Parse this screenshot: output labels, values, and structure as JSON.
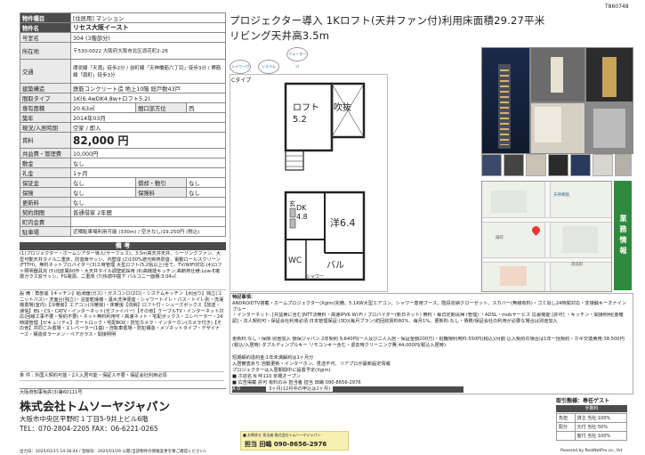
{
  "corner_id": "T860748",
  "spec": {
    "rows": [
      {
        "label": "物件種目",
        "value": "[住居用] マンション"
      },
      {
        "label": "物件名",
        "value": "リセス大阪イースト"
      },
      {
        "label": "号室名",
        "value": "304 (3階部分)"
      },
      {
        "label": "所在地",
        "value": "〒530-0022 大阪府大阪市北区浪花町2-28"
      },
      {
        "label": "交通",
        "value": "環状線「天満」徒歩2分 / 谷町線「天神橋筋六丁目」徒歩3分 / 堺筋線「扇町」徒歩3分"
      },
      {
        "label": "建築構造",
        "value": "鉄筋コンクリート造 地上10階 総戸数43戸"
      },
      {
        "label": "間取タイプ",
        "value": "1K(6.4wDK4.8w+ロフト5.2)"
      },
      {
        "label": "専有面積",
        "value": "20.63㎡"
      },
      {
        "label": "築年",
        "value": "2014年03月"
      },
      {
        "label": "現況/入居時期",
        "value": "空家 / 即入"
      }
    ],
    "side_label": "間口部方位",
    "side_value": "西",
    "rent_label": "賃料",
    "rent_value": "82,000 円",
    "rows2": [
      {
        "label": "共益費・管理費",
        "value": "10,000円"
      },
      {
        "label": "敷金",
        "value": "なし"
      },
      {
        "label": "礼金",
        "value": "1ヶ月"
      },
      {
        "label": "保証金",
        "value": "なし",
        "label2": "償却・敷引",
        "value2": "なし"
      },
      {
        "label": "保険",
        "value": "なし",
        "label2": "保険料",
        "value2": "なし"
      },
      {
        "label": "更新料",
        "value": "なし"
      },
      {
        "label": "契約期間",
        "value": "普通借家 2年間"
      },
      {
        "label": "町内会費",
        "value": ""
      },
      {
        "label": "駐車場",
        "value": "近隣駐車場利用可能 (330m) / 空きなし/19,250円 (税込)"
      }
    ]
  },
  "notes": {
    "title": "備 考",
    "body1": "(1)プロジェクター・ホームシアター導入(サーフェス)、3.5m高天井天井、シーリングファン、大型可動天井タイル二重床、防音扉サッシ、内壁成 (2)100%遮光断熱防音、電動ロールスクリーン(FTTH)、無料ネットブロバイダー(3)エ時管理 大型ロフト(5.2帖以上)全て、TV/WIFI対応 (4)ロフト照明器具完 (5)北欧風60作・大天井タイル調壁紙採用 (6)高機能キッチン:高断熱仕様:Low-E複層ガラス窓サッシ、FG電源、二重床 (7)快適中庭下 バルコニー面積:3.04㎡",
    "body2": "設 備 : 角部屋【キッチン】給湯器(ガス)・ガスコンロ(2口)・システムキッチン【水回り】独立(ユニットバス)・洗面台(独立)・浴室乾燥機・温水洗浄便座・シャワートイレ・バス・トイレ別・洗濯機置場(室内)【冷暖房】エアコン(冷暖房)・床暖房【収納】ロフト付・シューズボックス【放送・通信】BS・CS・CATV・インターネット(光ファイバー)【その他】ケーブルTV・インターネット対応(回線工事不要・契約不要)・ネット無料利用可・高速ネット・宅配ボックス・エレベーター・24時間管理【セキュリティ】オートロック・宅配BOX・防犯カメラ・インターホン(カメラ付き)【その他】共同ごみ置場・エレベーター(1基)・自転車置場・防犯構造・メゾネットタイプ・デザイナーズ・構造体ラーメン・ペアガラス・間接照明",
    "conditions": "条 件 : 外国人契約可能・2人入居可能・保証人不要・保証会社利用必須"
  },
  "company": {
    "license": "大阪府知事免許(3)第60111号",
    "name": "株式会社トムソーヤジャパン",
    "address": "大阪市中央区平野町１丁目5-9井上ビル6階",
    "tel_fax": "TEL：070-2804-2205 FAX：06-6221-0265"
  },
  "headline": "プロジェクター導入 1Kロフト(天井ファン付)利用床面積29.27平米 リビング天井高3.5m",
  "icons": [
    "シャワー付",
    "システム",
    "ウォーターロ"
  ],
  "floorplan": {
    "type_label": "Cタイプ",
    "loft_label": "ロフト",
    "loft_size": "5.2",
    "atrium": "吹抜",
    "dk_label": "DK",
    "dk_size": "4.8",
    "yo_label": "洋6.4",
    "wc": "WC",
    "balcony": "バル",
    "entry": "玄",
    "shower": "シャワー"
  },
  "side_badge": "業務情報",
  "map_labels": [
    "天神橋筋",
    "浪花町",
    "扇町"
  ],
  "special": {
    "title": "特記事項：",
    "body": "ANDROIDTV搭載・ホームプロジェクター(Xgim)完備、5.1KW大型エアコン、シャワー専用ブース、階段収納クローゼット、スカバー(無線有料)・ゴミ出し24時間対応・非接触キーオナインブルー",
    "body_b": "・インターネット: [共益費に含む]NTT法無料・高速IPV6 Wi-Fi / プロバイダー(新日ネット) 無料・毎日定期清掃 (管理) ・ADSL・mobサービス 応募機能 [許可] ・キッチン・間接照明[要確認]・法人契約可・保証会社利用必須 日本管理保証:(3D)(毎月プラン)初回総賃料80%、毎月1%、更新料:なし・債務/保証会社の利用が必要な場合は別途加入",
    "body_c": "更新料:なし・保険:別途加入 損保ジャパン 2年契約 9,640円(一人及び二人入居・保証金額200万)・駐輪場利用料:550円(税込)/月額 込入契約の場合は1年一括契約・カギ交換費用:38,500円(税込/入居時) ダブルディンプルキー リモコンキー含む・退去時クリーニング費:44,000円(税込入居時)",
    "body_d": "短期解約違約金:1年未満解約は1ヶ月分",
    "body_e": "入居審査あり:自動更新・インターホン、見送不可、リアプロが最新設定情報",
    "body_f": "プロジェクターは入居期間中に設置予定(Xgim)",
    "store_label": "■ ホ店名",
    "store": "N 呼110 京橋オープン",
    "ad_label": "■ 広告掲載",
    "ad": "許可 有料のみ 担当者 担当 田嶋 090-8656-2976",
    "move_label": "A  D",
    "move_value": "3ヶ月(12月中の申込は1ヶ月)"
  },
  "ad_contact": {
    "line1": "■ お問合せ 担当者 株式会社トムソーヤジャパン",
    "person": "担当 田嶋 090-8656-2976"
  },
  "fee": {
    "title": "取引態様：専任ゲスト",
    "header": "手数料",
    "rows": [
      {
        "k": "負担",
        "v": "貸主 当社:100%"
      },
      {
        "k": "配分",
        "v": "元付 当社:50%"
      },
      {
        "k": "",
        "v": "客付 当社:100%"
      }
    ]
  },
  "footer": {
    "print": "出力日：2025/01/15 14:36:44 / 登録日：2025/01/29 公開(当該物件の情報変更を要ご確認ください)",
    "powered": "Powered by RealNetPro co., ltd."
  }
}
